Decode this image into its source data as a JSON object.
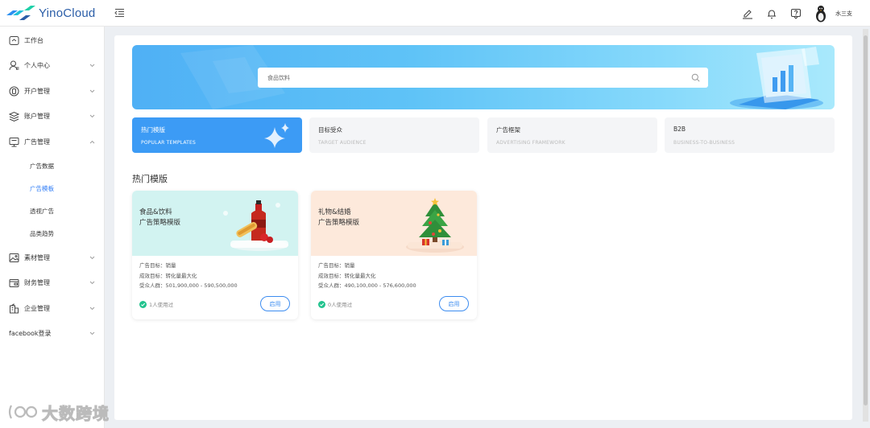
{
  "app": {
    "logo_text": "YinoCloud",
    "user_name": "水三支"
  },
  "sidebar": {
    "items": [
      {
        "label": "工作台",
        "icon": "home-icon"
      },
      {
        "label": "个人中心",
        "icon": "user-icon"
      },
      {
        "label": "开户管理",
        "icon": "account-open-icon"
      },
      {
        "label": "账户管理",
        "icon": "layers-icon"
      },
      {
        "label": "广告管理",
        "icon": "monitor-icon"
      }
    ],
    "sub_items": [
      {
        "label": "广告数据",
        "active": false
      },
      {
        "label": "广告模板",
        "active": true
      },
      {
        "label": "透视广告",
        "active": false
      },
      {
        "label": "品类趋势",
        "active": false
      }
    ],
    "items_after": [
      {
        "label": "素材管理",
        "icon": "image-icon"
      },
      {
        "label": "财务管理",
        "icon": "wallet-icon"
      },
      {
        "label": "企业管理",
        "icon": "building-icon"
      }
    ],
    "facebook_login": "facebook登录"
  },
  "search": {
    "value": "食品饮料"
  },
  "tabs": [
    {
      "title": "热门模版",
      "subtitle": "POPULAR TEMPLATES",
      "active": true
    },
    {
      "title": "目标受众",
      "subtitle": "TARGET AUDIENCE",
      "active": false
    },
    {
      "title": "广告框架",
      "subtitle": "ADVERTISING FRAMEWORK",
      "active": false
    },
    {
      "title": "B2B",
      "subtitle": "BUSINESS-TO-BUSINESS",
      "active": false
    }
  ],
  "section_title": "热门模版",
  "cards": [
    {
      "title1": "食品&饮料",
      "title2": "广告策略模版",
      "goal": "广告目标：销量",
      "result": "成效目标：转化量最大化",
      "audience": "受众人群：501,900,000 - 590,500,000",
      "used": "1人使用过",
      "button": "启用",
      "hero_color": "#d2f3f1"
    },
    {
      "title1": "礼物&结婚",
      "title2": "广告策略模版",
      "goal": "广告目标：销量",
      "result": "成效目标：转化量最大化",
      "audience": "受众人群：490,100,000 - 576,600,000",
      "used": "0人使用过",
      "button": "启用",
      "hero_color": "#fde9db"
    }
  ],
  "watermark": "大数跨境",
  "colors": {
    "accent": "#3c9bf5",
    "active_nav": "#2f7cf6",
    "brand": "#2b5ea8"
  }
}
